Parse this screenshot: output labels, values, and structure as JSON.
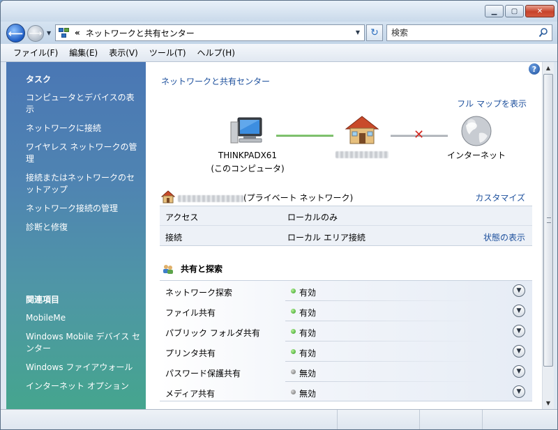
{
  "address": {
    "separator": "«",
    "path": "ネットワークと共有センター",
    "search_placeholder": "検索"
  },
  "menu": [
    "ファイル(F)",
    "編集(E)",
    "表示(V)",
    "ツール(T)",
    "ヘルプ(H)"
  ],
  "tasks": {
    "heading": "タスク",
    "items": [
      "コンピュータとデバイスの表示",
      "ネットワークに接続",
      "ワイヤレス ネットワークの管理",
      "接続またはネットワークのセットアップ",
      "ネットワーク接続の管理",
      "診断と修復"
    ]
  },
  "related": {
    "heading": "関連項目",
    "items": [
      "MobileMe",
      "Windows Mobile デバイス センター",
      "Windows ファイアウォール",
      "インターネット オプション"
    ]
  },
  "main": {
    "title": "ネットワークと共有センター",
    "full_map": "フル マップを表示",
    "computer_name": "THINKPADX61",
    "computer_sub": "(このコンピュータ)",
    "internet": "インターネット",
    "network_suffix": "(プライベート ネットワーク)",
    "customize": "カスタマイズ",
    "access_label": "アクセス",
    "access_value": "ローカルのみ",
    "connection_label": "接続",
    "connection_value": "ローカル エリア接続",
    "view_status": "状態の表示",
    "sharing_heading": "共有と探索",
    "sharing": [
      {
        "label": "ネットワーク探索",
        "status": "有効",
        "on": true
      },
      {
        "label": "ファイル共有",
        "status": "有効",
        "on": true
      },
      {
        "label": "パブリック フォルダ共有",
        "status": "有効",
        "on": true
      },
      {
        "label": "プリンタ共有",
        "status": "有効",
        "on": true
      },
      {
        "label": "パスワード保護共有",
        "status": "無効",
        "on": false
      },
      {
        "label": "メディア共有",
        "status": "無効",
        "on": false
      }
    ]
  },
  "colors": {
    "link": "#1c4f9c",
    "enabled_dot": "#2e9a1e",
    "disabled_dot": "#6b6b6b",
    "disconnect_x": "#d32a22"
  }
}
